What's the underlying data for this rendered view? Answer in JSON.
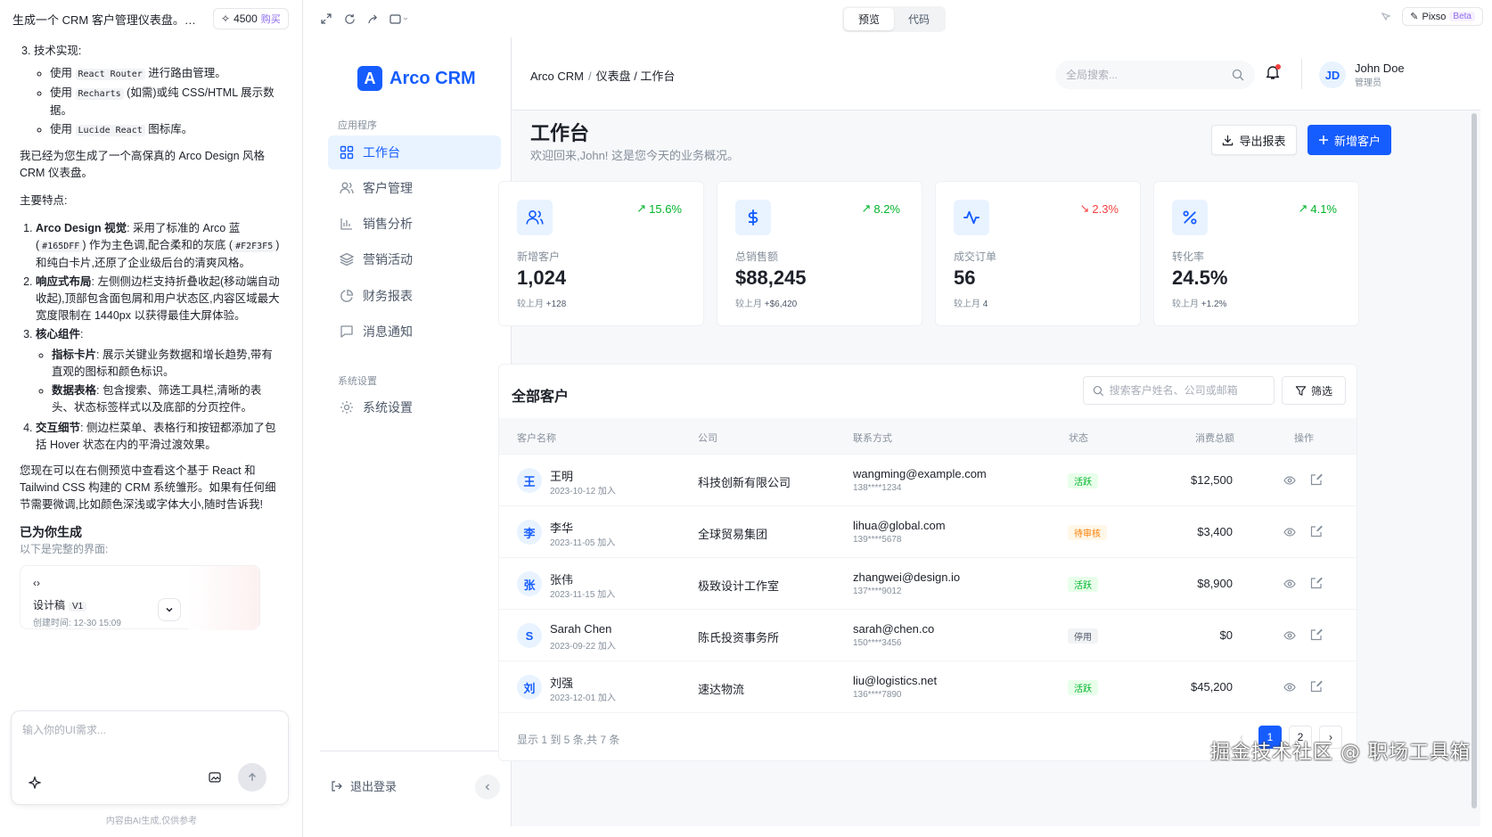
{
  "chat": {
    "title": "生成一个 CRM 客户管理仪表盘。左...",
    "credits": "4500",
    "buy_label": "购买",
    "sections": {
      "tech_heading": "3. 技术实现:",
      "tech_1_pre": "使用",
      "tech_1_code": "React Router",
      "tech_1_post": "进行路由管理。",
      "tech_2_pre": "使用",
      "tech_2_code": "Recharts",
      "tech_2_post": "(如需)或纯 CSS/HTML 展示数据。",
      "tech_3_pre": "使用",
      "tech_3_code": "Lucide React",
      "tech_3_post": "图标库。",
      "summary": "我已经为您生成了一个高保真的 Arco Design 风格 CRM 仪表盘。",
      "features_heading": "主要特点:",
      "f1_title": "Arco Design 视觉",
      "f1_a": ": 采用了标准的 Arco 蓝 (",
      "f1_code1": "#165DFF",
      "f1_b": ") 作为主色调,配合柔和的灰底 (",
      "f1_code2": "#F2F3F5",
      "f1_c": ") 和纯白卡片,还原了企业级后台的清爽风格。",
      "f2_title": "响应式布局",
      "f2_text": ": 左侧侧边栏支持折叠收起(移动端自动收起),顶部包含面包屑和用户状态区,内容区域最大宽度限制在 1440px 以获得最佳大屏体验。",
      "f3_title": "核心组件",
      "f3_sub1_title": "指标卡片",
      "f3_sub1_text": ": 展示关键业务数据和增长趋势,带有直观的图标和颜色标识。",
      "f3_sub2_title": "数据表格",
      "f3_sub2_text": ": 包含搜索、筛选工具栏,清晰的表头、状态标签样式以及底部的分页控件。",
      "f4_title": "交互细节",
      "f4_text": ": 侧边栏菜单、表格行和按钮都添加了包括 Hover 状态在内的平滑过渡效果。",
      "closing": "您现在可以在右侧预览中查看这个基于 React 和 Tailwind CSS 构建的 CRM 系统雏形。如果有任何细节需要微调,比如颜色深浅或字体大小,随时告诉我!"
    },
    "generated_title": "已为你生成",
    "generated_sub": "以下是完整的界面:",
    "artifact_name": "设计稿",
    "artifact_version": "V1",
    "artifact_time": "创建时间: 12-30 15:09",
    "input_placeholder": "输入你的UI需求...",
    "footer": "内容由AI生成,仅供参考"
  },
  "toolbar": {
    "tab_preview": "预览",
    "tab_code": "代码",
    "pixso_label": "Pixso",
    "beta_label": "Beta"
  },
  "app": {
    "brand": "Arco CRM",
    "logo_letter": "A",
    "nav_group_app": "应用程序",
    "nav_group_sys": "系统设置",
    "nav": [
      "工作台",
      "客户管理",
      "销售分析",
      "营销活动",
      "财务报表",
      "消息通知",
      "系统设置"
    ],
    "logout": "退出登录",
    "breadcrumb": [
      "Arco CRM",
      "/",
      "仪表盘 / 工作台"
    ],
    "search_placeholder": "全局搜索...",
    "user_initials": "JD",
    "user_name": "John Doe",
    "user_role": "管理员",
    "page_title": "工作台",
    "page_subtitle": "欢迎回来,John! 这是您今天的业务概况。",
    "btn_export": "导出报表",
    "btn_add": "新增客户",
    "accent": "#165DFF"
  },
  "stats": [
    {
      "icon": "users-icon",
      "trend": "15.6%",
      "dir": "up",
      "label": "新增客户",
      "value": "1,024",
      "cmp_label": "较上月",
      "cmp": "+128"
    },
    {
      "icon": "dollar-icon",
      "trend": "8.2%",
      "dir": "up",
      "label": "总销售额",
      "value": "$88,245",
      "cmp_label": "较上月",
      "cmp": "+$6,420"
    },
    {
      "icon": "activity-icon",
      "trend": "2.3%",
      "dir": "down",
      "label": "成交订单",
      "value": "56",
      "cmp_label": "较上月",
      "cmp": "4"
    },
    {
      "icon": "percent-icon",
      "trend": "4.1%",
      "dir": "up",
      "label": "转化率",
      "value": "24.5%",
      "cmp_label": "较上月",
      "cmp": "+1.2%"
    }
  ],
  "table": {
    "title": "全部客户",
    "search_placeholder": "搜索客户姓名、公司或邮箱",
    "filter_label": "筛选",
    "headers": [
      "客户名称",
      "公司",
      "联系方式",
      "状态",
      "消费总额",
      "操作"
    ],
    "rows": [
      {
        "avatar": "王",
        "name": "王明",
        "joined": "2023-10-12 加入",
        "company": "科技创新有限公司",
        "email": "wangming@example.com",
        "phone": "138****1234",
        "status": "活跃",
        "status_color": "green",
        "amount": "$12,500"
      },
      {
        "avatar": "李",
        "name": "李华",
        "joined": "2023-11-05 加入",
        "company": "全球贸易集团",
        "email": "lihua@global.com",
        "phone": "139****5678",
        "status": "待审核",
        "status_color": "orange",
        "amount": "$3,400"
      },
      {
        "avatar": "张",
        "name": "张伟",
        "joined": "2023-11-15 加入",
        "company": "极致设计工作室",
        "email": "zhangwei@design.io",
        "phone": "137****9012",
        "status": "活跃",
        "status_color": "green",
        "amount": "$8,900"
      },
      {
        "avatar": "S",
        "name": "Sarah Chen",
        "joined": "2023-09-22 加入",
        "company": "陈氏投资事务所",
        "email": "sarah@chen.co",
        "phone": "150****3456",
        "status": "停用",
        "status_color": "gray",
        "amount": "$0"
      },
      {
        "avatar": "刘",
        "name": "刘强",
        "joined": "2023-12-01 加入",
        "company": "速达物流",
        "email": "liu@logistics.net",
        "phone": "136****7890",
        "status": "活跃",
        "status_color": "green",
        "amount": "$45,200"
      }
    ],
    "footer_info": "显示 1 到 5 条,共 7 条",
    "pages": [
      "1",
      "2"
    ]
  },
  "watermark": "掘金技术社区 @ 职场工具箱"
}
